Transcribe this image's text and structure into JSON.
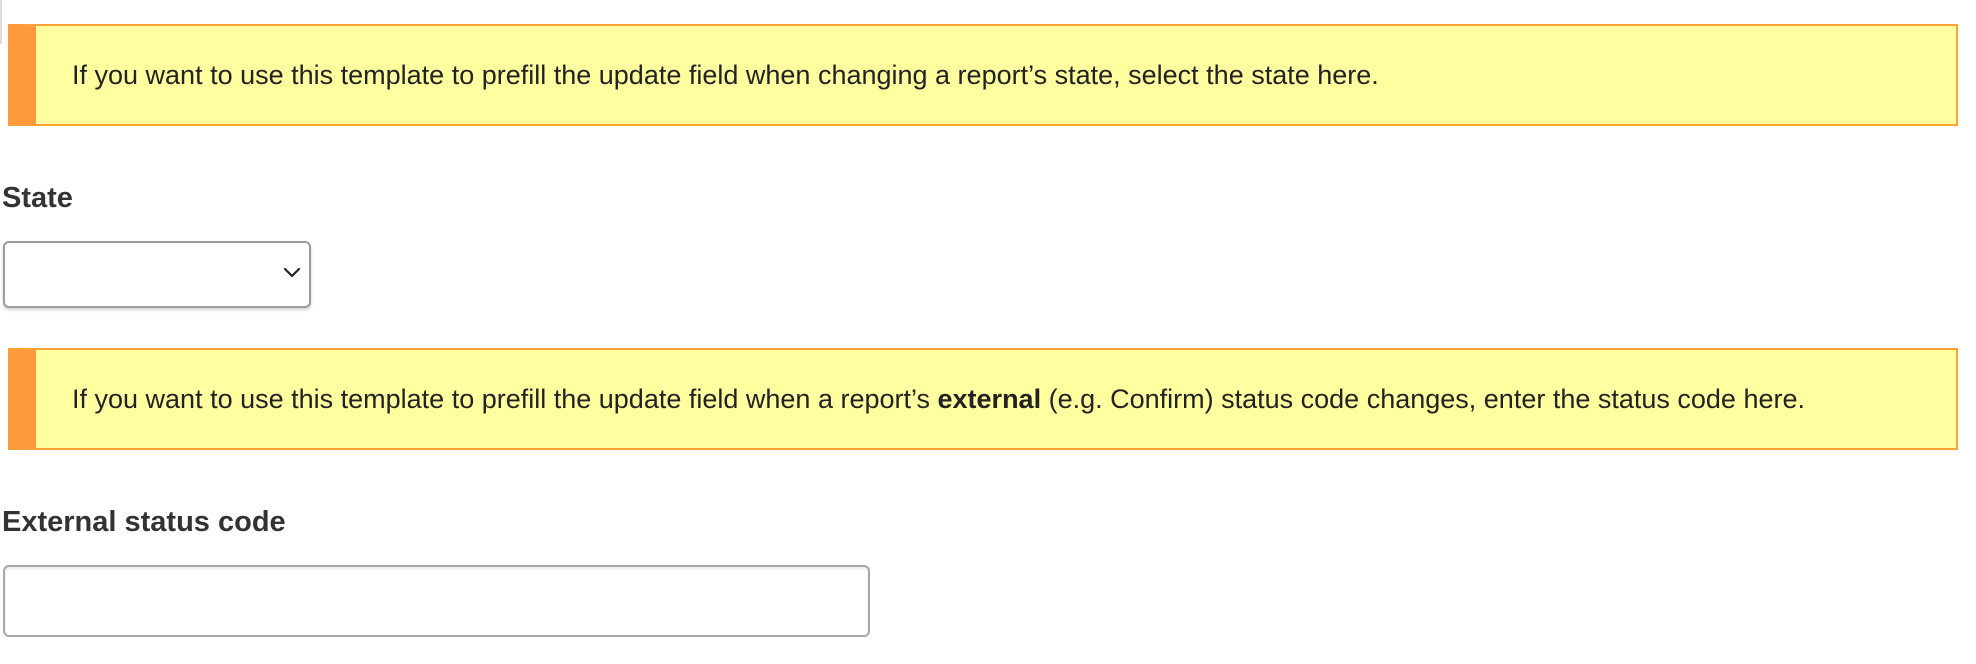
{
  "notices": {
    "state_help": "If you want to use this template to prefill the update field when changing a report’s state, select the state here.",
    "external_help_before": "If you want to use this template to prefill the update field when a report’s ",
    "external_help_bold": "external",
    "external_help_after": " (e.g. Confirm) status code changes, enter the status code here."
  },
  "state_field": {
    "label": "State",
    "selected_value": ""
  },
  "external_status_field": {
    "label": "External status code",
    "value": "",
    "placeholder": ""
  },
  "colors": {
    "notice_background": "#ffffa0",
    "notice_accent": "#ff9b3d"
  },
  "icons": {
    "select_indicator": "chevron-down-icon"
  }
}
